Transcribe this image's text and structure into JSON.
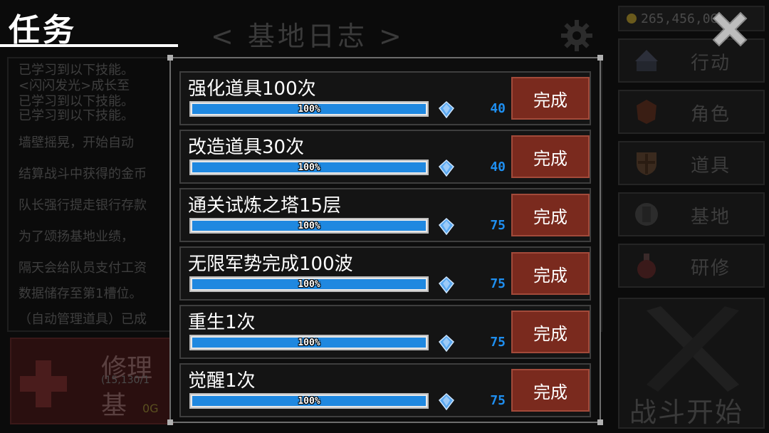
{
  "header": {
    "title": "任务"
  },
  "background": {
    "page_title": "< 基地日志 >",
    "log_lines": [
      "已学习到以下技能。",
      "<闪闪发光>成长至",
      "已学习到以下技能。",
      "已学习到以下技能。",
      "墙壁摇晃，开始自动",
      "结算战斗中获得的金币",
      "队长强行提走银行存款",
      "为了颂扬基地业绩，",
      "隔天会给队员支付工资",
      "数据储存至第1槽位。",
      "（自动管理道具）已成"
    ],
    "repair": {
      "title": "修理基",
      "subtitle": "(15,130/1",
      "gold": "0G"
    },
    "gold": "265,456,0G",
    "side_buttons": [
      {
        "label": "行动",
        "icon": "camp-icon"
      },
      {
        "label": "角色",
        "icon": "helmet-icon"
      },
      {
        "label": "道具",
        "icon": "shield-icon"
      },
      {
        "label": "基地",
        "icon": "base-icon"
      },
      {
        "label": "研修",
        "icon": "potion-icon"
      }
    ],
    "battle_label": "战斗开始"
  },
  "quests": [
    {
      "name": "强化道具100次",
      "progress": 1.0,
      "progress_text": "100%",
      "reward": "40",
      "button": "完成"
    },
    {
      "name": "改造道具30次",
      "progress": 1.0,
      "progress_text": "100%",
      "reward": "40",
      "button": "完成"
    },
    {
      "name": "通关试炼之塔15层",
      "progress": 1.0,
      "progress_text": "100%",
      "reward": "75",
      "button": "完成"
    },
    {
      "name": "无限军势完成100波",
      "progress": 1.0,
      "progress_text": "100%",
      "reward": "75",
      "button": "完成"
    },
    {
      "name": "重生1次",
      "progress": 1.0,
      "progress_text": "100%",
      "reward": "75",
      "button": "完成"
    },
    {
      "name": "觉醒1次",
      "progress": 1.0,
      "progress_text": "100%",
      "reward": "75",
      "button": "完成"
    }
  ],
  "colors": {
    "accent_blue": "#1f88e0",
    "reward_blue": "#1f8ff0",
    "button_red": "#7a2a1e"
  }
}
